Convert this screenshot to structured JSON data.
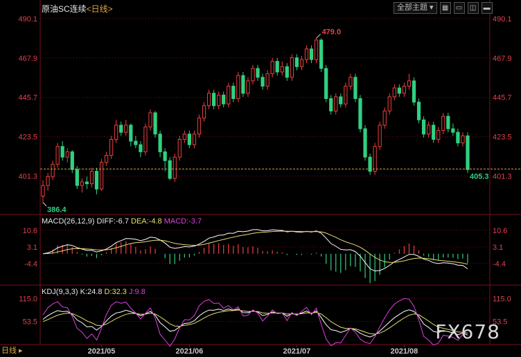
{
  "header": {
    "title": "原油SC连续",
    "subtitle": "<日线>",
    "theme_button": "全部主题 ▾",
    "icons": [
      "grid-icon",
      "window-icon",
      "split-icon",
      "minimize-icon"
    ]
  },
  "macd_label": {
    "name": "MACD(26,12,9)",
    "diff": "DIFF:-6.7",
    "dea": "DEA:-4.8",
    "macd": "MACD:-3.7"
  },
  "kdj_label": {
    "name": "KDJ(9,3,3)",
    "k": "K:24.8",
    "d": "D:32.3",
    "j": "J:9.8"
  },
  "watermark": "FX678",
  "corner_text": "日线 ▸",
  "colors": {
    "up": "#f04040",
    "down": "#30d080",
    "diff": "#ffffff",
    "dea": "#e8e070",
    "j": "#e040e0",
    "axis": "#e04050",
    "grid": "#7a1020"
  },
  "chart_data": {
    "type": "candlestick",
    "price_axis": {
      "ticks": [
        490.1,
        467.9,
        445.7,
        423.5,
        401.3
      ],
      "ylim": [
        382,
        492
      ]
    },
    "x_ticks": [
      "2021/05",
      "2021/06",
      "2021/07",
      "2021/08"
    ],
    "last_price": 405.3,
    "high_annotation": 479.0,
    "low_annotation": 386.4,
    "candles": [
      [
        390,
        396,
        399,
        386
      ],
      [
        396,
        401,
        403,
        393
      ],
      [
        401,
        408,
        410,
        399
      ],
      [
        408,
        418,
        420,
        406
      ],
      [
        418,
        412,
        421,
        410
      ],
      [
        412,
        415,
        417,
        409
      ],
      [
        415,
        405,
        416,
        403
      ],
      [
        405,
        396,
        407,
        394
      ],
      [
        396,
        398,
        400,
        392
      ],
      [
        398,
        397,
        401,
        394
      ],
      [
        397,
        404,
        406,
        395
      ],
      [
        404,
        394,
        406,
        391
      ],
      [
        394,
        409,
        411,
        393
      ],
      [
        409,
        413,
        415,
        407
      ],
      [
        413,
        422,
        424,
        411
      ],
      [
        422,
        430,
        433,
        420
      ],
      [
        430,
        426,
        432,
        424
      ],
      [
        426,
        430,
        433,
        424
      ],
      [
        430,
        421,
        431,
        418
      ],
      [
        421,
        419,
        424,
        417
      ],
      [
        419,
        415,
        421,
        412
      ],
      [
        415,
        429,
        431,
        413
      ],
      [
        429,
        437,
        439,
        427
      ],
      [
        437,
        425,
        438,
        423
      ],
      [
        425,
        415,
        427,
        412
      ],
      [
        415,
        410,
        417,
        404
      ],
      [
        410,
        400,
        412,
        399
      ],
      [
        400,
        412,
        414,
        398
      ],
      [
        412,
        422,
        424,
        410
      ],
      [
        422,
        425,
        427,
        420
      ],
      [
        425,
        419,
        427,
        417
      ],
      [
        419,
        425,
        427,
        417
      ],
      [
        425,
        434,
        436,
        423
      ],
      [
        434,
        441,
        443,
        432
      ],
      [
        441,
        448,
        450,
        439
      ],
      [
        448,
        441,
        450,
        439
      ],
      [
        441,
        447,
        449,
        439
      ],
      [
        447,
        442,
        449,
        440
      ],
      [
        442,
        452,
        454,
        440
      ],
      [
        452,
        445,
        454,
        443
      ],
      [
        445,
        458,
        460,
        443
      ],
      [
        458,
        448,
        460,
        446
      ],
      [
        448,
        455,
        457,
        446
      ],
      [
        455,
        462,
        464,
        453
      ],
      [
        462,
        457,
        464,
        455
      ],
      [
        457,
        452,
        459,
        450
      ],
      [
        452,
        459,
        461,
        450
      ],
      [
        459,
        466,
        468,
        457
      ],
      [
        466,
        460,
        468,
        458
      ],
      [
        460,
        463,
        466,
        458
      ],
      [
        463,
        457,
        465,
        455
      ],
      [
        457,
        468,
        470,
        455
      ],
      [
        468,
        463,
        470,
        461
      ],
      [
        463,
        467,
        469,
        461
      ],
      [
        467,
        473,
        475,
        465
      ],
      [
        473,
        467,
        475,
        465
      ],
      [
        467,
        478,
        479,
        465
      ],
      [
        478,
        462,
        479,
        460
      ],
      [
        462,
        445,
        464,
        443
      ],
      [
        445,
        438,
        447,
        436
      ],
      [
        438,
        446,
        448,
        436
      ],
      [
        446,
        442,
        448,
        440
      ],
      [
        442,
        452,
        454,
        440
      ],
      [
        452,
        457,
        459,
        450
      ],
      [
        457,
        445,
        459,
        443
      ],
      [
        445,
        428,
        447,
        426
      ],
      [
        428,
        412,
        430,
        410
      ],
      [
        412,
        404,
        414,
        402
      ],
      [
        404,
        418,
        420,
        402
      ],
      [
        418,
        430,
        432,
        416
      ],
      [
        430,
        438,
        440,
        428
      ],
      [
        438,
        446,
        448,
        436
      ],
      [
        446,
        451,
        453,
        444
      ],
      [
        451,
        448,
        453,
        446
      ],
      [
        448,
        452,
        454,
        446
      ],
      [
        452,
        455,
        459,
        450
      ],
      [
        455,
        443,
        457,
        441
      ],
      [
        443,
        433,
        445,
        431
      ],
      [
        433,
        425,
        435,
        423
      ],
      [
        425,
        430,
        432,
        423
      ],
      [
        430,
        422,
        432,
        420
      ],
      [
        422,
        427,
        429,
        420
      ],
      [
        427,
        435,
        437,
        425
      ],
      [
        435,
        428,
        437,
        426
      ],
      [
        428,
        426,
        431,
        424
      ],
      [
        426,
        420,
        428,
        418
      ],
      [
        420,
        424,
        426,
        418
      ],
      [
        424,
        405,
        426,
        403
      ]
    ],
    "macd_axis": {
      "ticks": [
        10.6,
        3.1,
        -4.4
      ],
      "ylim": [
        -11,
        14
      ]
    },
    "kdj_axis": {
      "ticks": [
        115.0,
        53.5
      ],
      "ylim": [
        -5,
        125
      ]
    }
  }
}
